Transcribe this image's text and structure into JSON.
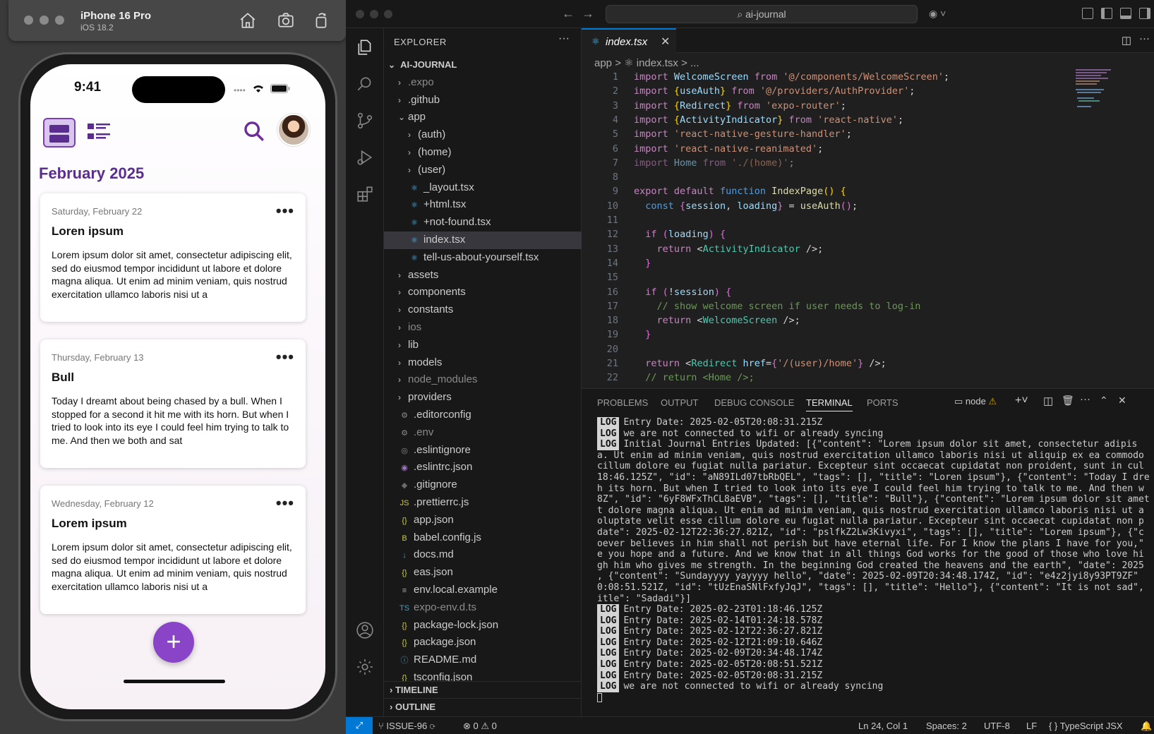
{
  "simulator": {
    "device": "iPhone 16 Pro",
    "os": "iOS 18.2"
  },
  "phone": {
    "time": "9:41",
    "month_header": "February 2025",
    "cards": [
      {
        "date": "Saturday, February 22",
        "title": "Loren ipsum",
        "body": "Lorem ipsum dolor sit amet, consectetur adipiscing elit, sed do eiusmod tempor incididunt ut labore et dolore magna aliqua. Ut enim ad minim veniam, quis nostrud exercitation ullamco laboris nisi ut a"
      },
      {
        "date": "Thursday, February 13",
        "title": "Bull",
        "body": "Today I dreamt about being chased by a bull. When I stopped for a second it hit me with its horn. But when I tried to look into its eye I could feel him trying to talk to me. And then we both and sat"
      },
      {
        "date": "Wednesday, February 12",
        "title": "Lorem ipsum",
        "body": "Lorem ipsum dolor sit amet, consectetur adipiscing elit, sed do eiusmod tempor incididunt ut labore et dolore magna aliqua. Ut enim ad minim veniam, quis nostrud exercitation ullamco laboris nisi ut a"
      }
    ],
    "more_glyph": "•••",
    "fab_label": "+"
  },
  "vscode": {
    "search_text": "ai-journal",
    "explorer_title": "EXPLORER",
    "explorer_more": "···",
    "project": "AI-JOURNAL",
    "tree": [
      {
        "label": ".expo",
        "type": "folder",
        "indent": 1,
        "open": false,
        "dim": true
      },
      {
        "label": ".github",
        "type": "folder",
        "indent": 1,
        "open": false
      },
      {
        "label": "app",
        "type": "folder",
        "indent": 1,
        "open": true
      },
      {
        "label": "(auth)",
        "type": "folder",
        "indent": 2,
        "open": false
      },
      {
        "label": "(home)",
        "type": "folder",
        "indent": 2,
        "open": false
      },
      {
        "label": "(user)",
        "type": "folder",
        "indent": 2,
        "open": false
      },
      {
        "label": "_layout.tsx",
        "type": "react",
        "indent": 2
      },
      {
        "label": "+html.tsx",
        "type": "react",
        "indent": 2
      },
      {
        "label": "+not-found.tsx",
        "type": "react",
        "indent": 2
      },
      {
        "label": "index.tsx",
        "type": "react",
        "indent": 2,
        "selected": true
      },
      {
        "label": "tell-us-about-yourself.tsx",
        "type": "react",
        "indent": 2
      },
      {
        "label": "assets",
        "type": "folder",
        "indent": 1,
        "open": false
      },
      {
        "label": "components",
        "type": "folder",
        "indent": 1,
        "open": false
      },
      {
        "label": "constants",
        "type": "folder",
        "indent": 1,
        "open": false
      },
      {
        "label": "ios",
        "type": "folder",
        "indent": 1,
        "open": false,
        "dim": true
      },
      {
        "label": "lib",
        "type": "folder",
        "indent": 1,
        "open": false
      },
      {
        "label": "models",
        "type": "folder",
        "indent": 1,
        "open": false
      },
      {
        "label": "node_modules",
        "type": "folder",
        "indent": 1,
        "open": false,
        "dim": true
      },
      {
        "label": "providers",
        "type": "folder",
        "indent": 1,
        "open": false
      },
      {
        "label": ".editorconfig",
        "type": "gear",
        "indent": 1
      },
      {
        "label": ".env",
        "type": "gear",
        "indent": 1,
        "dim": true
      },
      {
        "label": ".eslintignore",
        "type": "circle",
        "indent": 1
      },
      {
        "label": ".eslintrc.json",
        "type": "eslint",
        "indent": 1
      },
      {
        "label": ".gitignore",
        "type": "git",
        "indent": 1
      },
      {
        "label": ".prettierrc.js",
        "type": "js",
        "indent": 1
      },
      {
        "label": "app.json",
        "type": "json",
        "indent": 1
      },
      {
        "label": "babel.config.js",
        "type": "babel",
        "indent": 1
      },
      {
        "label": "docs.md",
        "type": "md",
        "indent": 1
      },
      {
        "label": "eas.json",
        "type": "json",
        "indent": 1
      },
      {
        "label": "env.local.example",
        "type": "lines",
        "indent": 1
      },
      {
        "label": "expo-env.d.ts",
        "type": "ts",
        "indent": 1,
        "dim": true
      },
      {
        "label": "package-lock.json",
        "type": "json",
        "indent": 1
      },
      {
        "label": "package.json",
        "type": "json",
        "indent": 1
      },
      {
        "label": "README.md",
        "type": "info",
        "indent": 1
      },
      {
        "label": "tsconfig.json",
        "type": "json",
        "indent": 1
      }
    ],
    "sections": [
      "TIMELINE",
      "OUTLINE"
    ],
    "tab_label": "index.tsx",
    "breadcrumb": "app > ⚛ index.tsx > ...",
    "line_numbers": [
      "1",
      "2",
      "3",
      "4",
      "5",
      "6",
      "7",
      "8",
      "9",
      "10",
      "11",
      "12",
      "13",
      "14",
      "15",
      "16",
      "17",
      "18",
      "19",
      "20",
      "21",
      "22"
    ],
    "panel_tabs": [
      "PROBLEMS",
      "OUTPUT",
      "DEBUG CONSOLE",
      "TERMINAL",
      "PORTS"
    ],
    "terminal_shell": "node",
    "terminal_lines": [
      {
        "log": true,
        "text": "Entry Date: 2025-02-05T20:08:31.215Z"
      },
      {
        "log": true,
        "text": "we are not connected to wifi or already syncing"
      },
      {
        "log": true,
        "text": "Initial Journal Entries Updated: [{\"content\": \"Lorem ipsum dolor sit amet, consectetur adipis"
      },
      {
        "log": false,
        "text": "a. Ut enim ad minim veniam, quis nostrud exercitation ullamco laboris nisi ut aliquip ex ea commodo"
      },
      {
        "log": false,
        "text": "cillum dolore eu fugiat nulla pariatur. Excepteur sint occaecat cupidatat non proident, sunt in cul"
      },
      {
        "log": false,
        "text": "18:46.125Z\", \"id\": \"aN89ILd07tbRbQEL\", \"tags\": [], \"title\": \"Loren ipsum\"}, {\"content\": \"Today I dre"
      },
      {
        "log": false,
        "text": "h its horn. But when I tried to look into its eye I could feel him trying to talk to me. And then w"
      },
      {
        "log": false,
        "text": "8Z\", \"id\": \"6yF8WFxThCL8aEVB\", \"tags\": [], \"title\": \"Bull\"}, {\"content\": \"Lorem ipsum dolor sit amet"
      },
      {
        "log": false,
        "text": "t dolore magna aliqua. Ut enim ad minim veniam, quis nostrud exercitation ullamco laboris nisi ut a"
      },
      {
        "log": false,
        "text": "oluptate velit esse cillum dolore eu fugiat nulla pariatur. Excepteur sint occaecat cupidatat non p"
      },
      {
        "log": false,
        "text": "date\": 2025-02-12T22:36:27.821Z, \"id\": \"pslfkZ2Lw3Kivyxi\", \"tags\": [], \"title\": \"Lorem ipsum\"}, {\"c"
      },
      {
        "log": false,
        "text": "oever believes in him shall not perish but have eternal life. For I know the plans I have for you,\""
      },
      {
        "log": false,
        "text": "e you hope and a future. And we know that in all things God works for the good of those who love hi"
      },
      {
        "log": false,
        "text": "gh him who gives me strength. In the beginning God created the heavens and the earth\", \"date\": 2025"
      },
      {
        "log": false,
        "text": ", {\"content\": \"Sundayyyy yayyyy hello\", \"date\": 2025-02-09T20:34:48.174Z, \"id\": \"e4z2jyi8y93PT9ZF\""
      },
      {
        "log": false,
        "text": "0:08:51.521Z, \"id\": \"tUzEnaSNlFxfyJqJ\", \"tags\": [], \"title\": \"Hello\"}, {\"content\": \"It is not sad\","
      },
      {
        "log": false,
        "text": "itle\": \"Sadadi\"}]"
      },
      {
        "log": true,
        "text": "Entry Date: 2025-02-23T01:18:46.125Z"
      },
      {
        "log": true,
        "text": "Entry Date: 2025-02-14T01:24:18.578Z"
      },
      {
        "log": true,
        "text": "Entry Date: 2025-02-12T22:36:27.821Z"
      },
      {
        "log": true,
        "text": "Entry Date: 2025-02-12T21:09:10.646Z"
      },
      {
        "log": true,
        "text": "Entry Date: 2025-02-09T20:34:48.174Z"
      },
      {
        "log": true,
        "text": "Entry Date: 2025-02-05T20:08:51.521Z"
      },
      {
        "log": true,
        "text": "Entry Date: 2025-02-05T20:08:31.215Z"
      },
      {
        "log": true,
        "text": "we are not connected to wifi or already syncing"
      }
    ],
    "log_label": "LOG",
    "status": {
      "branch": "ISSUE-96",
      "errors": "0",
      "warnings": "0",
      "position": "Ln 24, Col 1",
      "spaces": "Spaces: 2",
      "encoding": "UTF-8",
      "eol": "LF",
      "language": "TypeScript JSX"
    }
  }
}
